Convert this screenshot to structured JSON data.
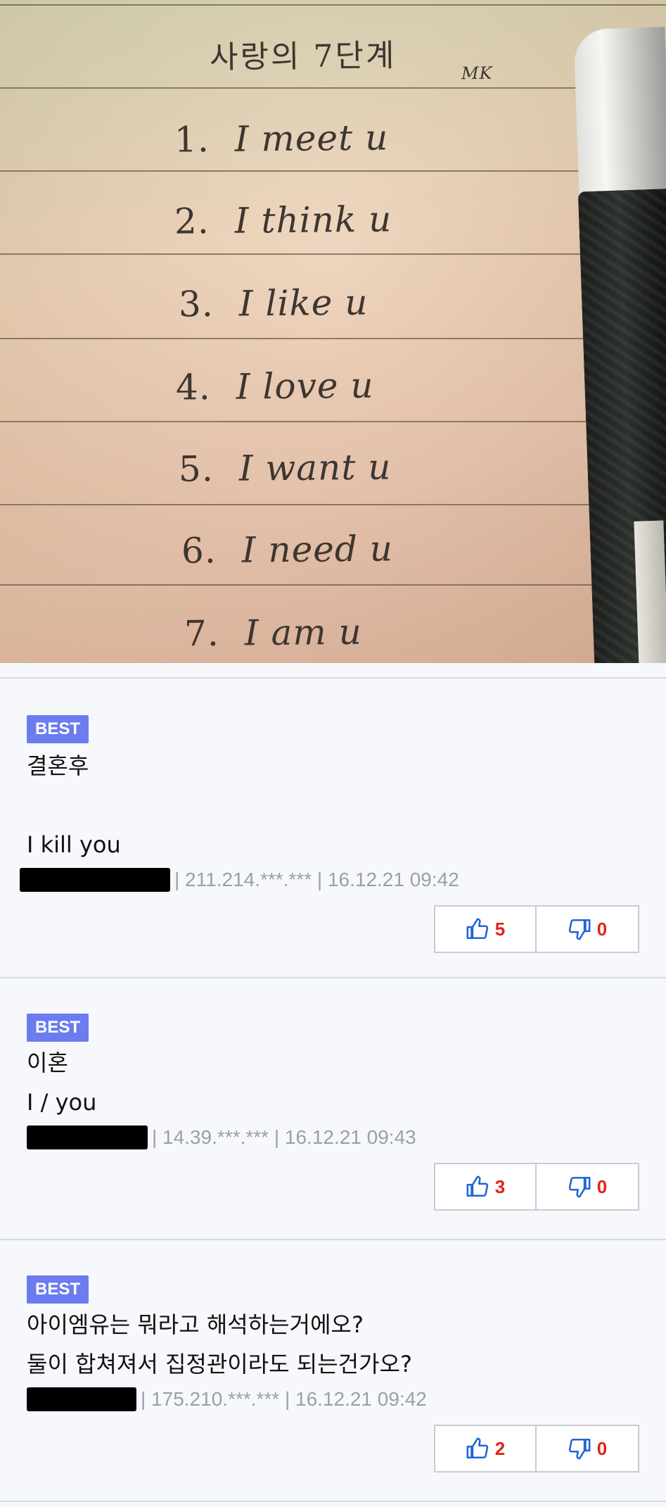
{
  "photo": {
    "title": "사랑의 7단계",
    "initials": "MK",
    "items": [
      {
        "num": "1.",
        "text": "I meet u"
      },
      {
        "num": "2.",
        "text": "I think u"
      },
      {
        "num": "3.",
        "text": "I like u"
      },
      {
        "num": "4.",
        "text": "I love u"
      },
      {
        "num": "5.",
        "text": "I want u"
      },
      {
        "num": "6.",
        "text": "I need u"
      },
      {
        "num": "7.",
        "text": "I am u"
      }
    ]
  },
  "comments": [
    {
      "badge": "BEST",
      "line1": "결혼후",
      "line2": "I kill you",
      "meta": "| 211.214.***.*** | 16.12.21 09:42",
      "likes": "5",
      "dislikes": "0"
    },
    {
      "badge": "BEST",
      "line1": "이혼",
      "line2": "I / you",
      "meta": "| 14.39.***.*** | 16.12.21 09:43",
      "likes": "3",
      "dislikes": "0"
    },
    {
      "badge": "BEST",
      "line1": "아이엠유는 뭐라고 해석하는거에오?",
      "line2": "둘이 합쳐져서 집정관이라도 되는건가오?",
      "meta": "| 175.210.***.*** | 16.12.21 09:42",
      "likes": "2",
      "dislikes": "0"
    }
  ],
  "colors": {
    "badge": "#6b7cf0",
    "vote_count": "#e0241b",
    "thumb_icon": "#1f66d6",
    "meta_text": "#9a9fa8"
  },
  "icons": {
    "like": "thumbs-up-icon",
    "dislike": "thumbs-down-icon"
  }
}
